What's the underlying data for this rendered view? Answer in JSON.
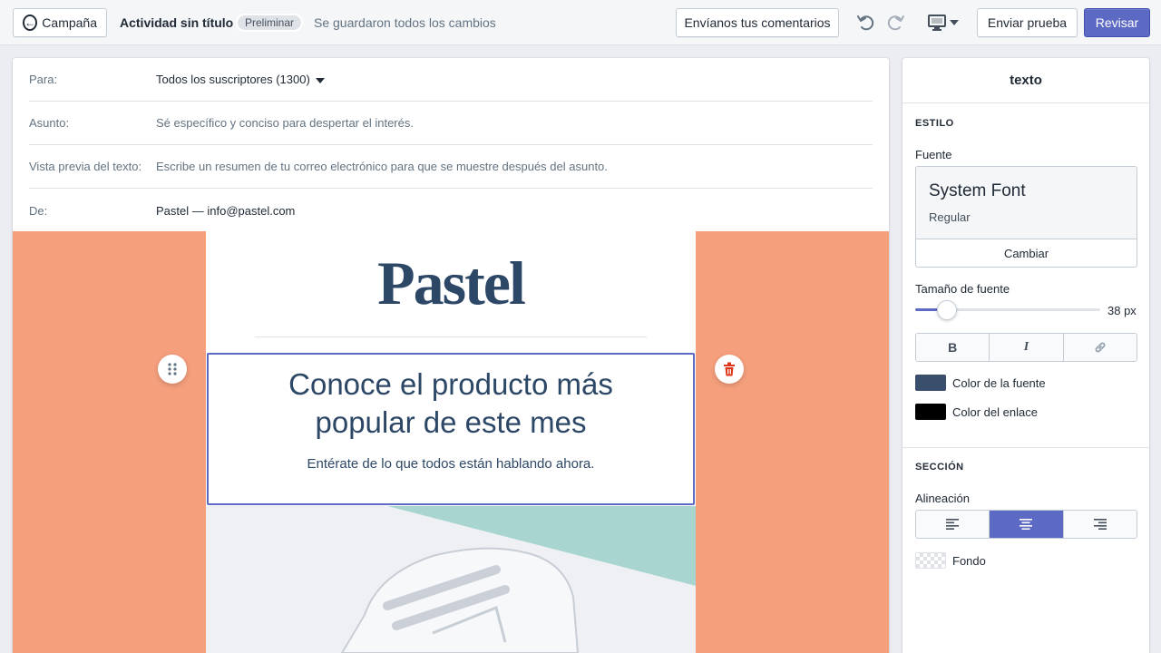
{
  "topbar": {
    "back_label": "Campaña",
    "doc_title": "Actividad sin título",
    "badge": "Preliminar",
    "saved_status": "Se guardaron todos los cambios",
    "feedback_label": "Envíanos tus comentarios",
    "undo_icon": "undo-icon",
    "redo_icon": "redo-icon",
    "device_icon": "desktop-icon",
    "send_test_label": "Enviar prueba",
    "review_label": "Revisar",
    "accent_color": "#5c6ac4"
  },
  "email_header": {
    "to_label": "Para:",
    "to_value": "Todos los suscriptores (1300)",
    "subject_label": "Asunto:",
    "subject_placeholder": "Sé específico y conciso para despertar el interés.",
    "preview_label": "Vista previa del texto:",
    "preview_placeholder": "Escribe un resumen de tu correo electrónico para que se muestre después del asunto.",
    "from_label": "De:",
    "from_value": "Pastel — info@pastel.com"
  },
  "email_body": {
    "background_color": "#f59f7c",
    "logo": "Pastel",
    "headline_line1": "Conoce el producto más",
    "headline_line2": "popular de este mes",
    "subline": "Entérate de lo que todos están hablando ahora."
  },
  "sidebar": {
    "title": "texto",
    "style_heading": "ESTILO",
    "font_label": "Fuente",
    "font_name": "System Font",
    "font_weight": "Regular",
    "change_label": "Cambiar",
    "size_label": "Tamaño de fuente",
    "size_value": "38 px",
    "size_slider_fraction": 0.17,
    "bold_label": "B",
    "italic_label": "I",
    "font_color_label": "Color de la fuente",
    "font_color": "#3a4f6c",
    "link_color_label": "Color del enlace",
    "link_color": "#000000",
    "section_heading": "SECCIÓN",
    "alignment_label": "Alineación",
    "alignment_selected": "center",
    "background_label": "Fondo"
  }
}
